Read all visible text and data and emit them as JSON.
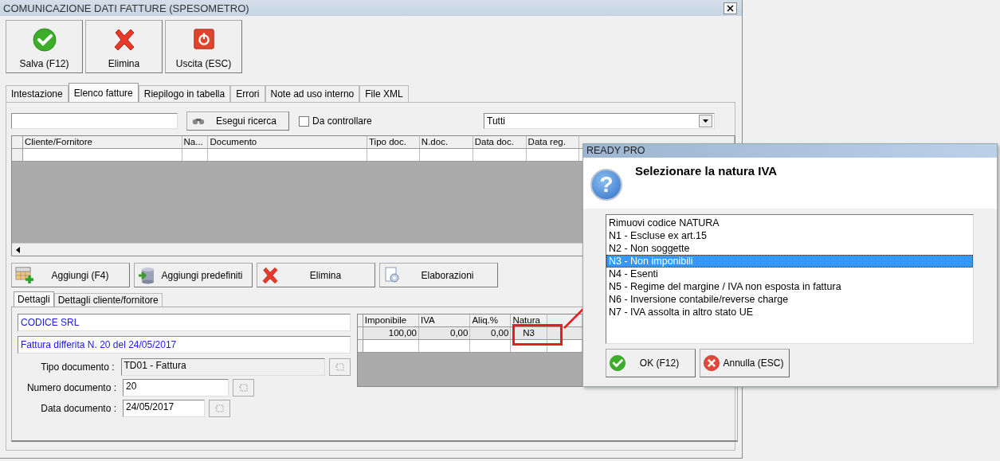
{
  "window": {
    "title": "COMUNICAZIONE DATI FATTURE (SPESOMETRO)"
  },
  "toolbar": [
    {
      "label": "Salva (F12)",
      "kind": "save"
    },
    {
      "label": "Elimina",
      "kind": "delete"
    },
    {
      "label": "Uscita (ESC)",
      "kind": "exit"
    }
  ],
  "tabs": [
    {
      "label": "Intestazione",
      "selected": false
    },
    {
      "label": "Elenco fatture",
      "selected": true
    },
    {
      "label": "Riepilogo in tabella",
      "selected": false
    },
    {
      "label": "Errori",
      "selected": false
    },
    {
      "label": "Note ad uso interno",
      "selected": false
    },
    {
      "label": "File XML",
      "selected": false
    }
  ],
  "filter": {
    "search_button": "Esegui ricerca",
    "checkbox": {
      "label": "Da controllare",
      "checked": false
    },
    "dropdown": {
      "value": "Tutti"
    }
  },
  "invoice_table": {
    "columns": [
      "Cliente/Fornitore",
      "Na...",
      "Documento",
      "Tipo doc.",
      "N.doc.",
      "Data doc.",
      "Data reg."
    ]
  },
  "actions": [
    {
      "label": "Aggiungi (F4)",
      "kind": "add"
    },
    {
      "label": "Aggiungi predefiniti",
      "kind": "database"
    },
    {
      "label": "Elimina",
      "kind": "delete"
    },
    {
      "label": "Elaborazioni",
      "kind": "process"
    }
  ],
  "detail_tabs": [
    {
      "label": "Dettagli",
      "selected": true
    },
    {
      "label": "Dettagli cliente/fornitore",
      "selected": false
    }
  ],
  "details": {
    "client": "CODICE SRL",
    "document": "Fattura differita N. 20 del 24/05/2017",
    "fields": [
      {
        "label": "Tipo documento :",
        "value": "TD01 - Fattura",
        "kind": "type",
        "disabled": true
      },
      {
        "label": "Numero documento :",
        "value": "20",
        "kind": "number",
        "disabled": false
      },
      {
        "label": "Data documento :",
        "value": "24/05/2017",
        "kind": "date",
        "disabled": false
      }
    ]
  },
  "vat_table": {
    "columns": [
      "Imponibile",
      "IVA",
      "Aliq.%",
      "Natura"
    ],
    "rows": [
      [
        "100,00",
        "0,00",
        "0,00",
        "N3"
      ]
    ]
  },
  "dialog": {
    "title": "READY PRO",
    "icon": "?",
    "message": "Selezionare la natura IVA",
    "options": [
      {
        "label": "Rimuovi codice NATURA",
        "selected": false
      },
      {
        "label": "N1 - Escluse ex art.15",
        "selected": false
      },
      {
        "label": "N2 - Non soggette",
        "selected": false
      },
      {
        "label": "N3 - Non imponibili",
        "selected": true
      },
      {
        "label": "N4 - Esenti",
        "selected": false
      },
      {
        "label": "N5 - Regime del margine / IVA non esposta in fattura",
        "selected": false
      },
      {
        "label": "N6 - Inversione contabile/reverse charge",
        "selected": false
      },
      {
        "label": "N7 - IVA assolta in altro stato UE",
        "selected": false
      }
    ],
    "buttons": [
      {
        "label": "OK (F12)",
        "kind": "ok"
      },
      {
        "label": "Annulla (ESC)",
        "kind": "cancel"
      }
    ]
  }
}
